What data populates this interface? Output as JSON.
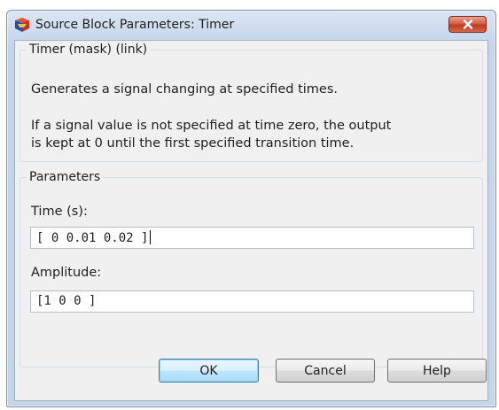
{
  "window": {
    "title": "Source Block Parameters: Timer"
  },
  "description": {
    "heading": "Timer (mask) (link)",
    "line1": "Generates a signal changing at specified times.",
    "line2": "If a signal value is not specified at time zero, the output",
    "line3": "is kept at 0 until the first specified transition time."
  },
  "parameters": {
    "heading": "Parameters",
    "time_label": "Time (s):",
    "time_value": "[ 0  0.01  0.02  ]",
    "amplitude_label": "Amplitude:",
    "amplitude_value": "[1 0 0 ]"
  },
  "buttons": {
    "ok": "OK",
    "cancel": "Cancel",
    "help": "Help"
  },
  "colors": {
    "titlebar": "#c8d8ec",
    "close_button": "#c0391d",
    "client_background": "#f0f0f0",
    "default_button_border": "#3c7fb1"
  },
  "icons": {
    "app": "simulink-icon",
    "close": "close-icon"
  }
}
